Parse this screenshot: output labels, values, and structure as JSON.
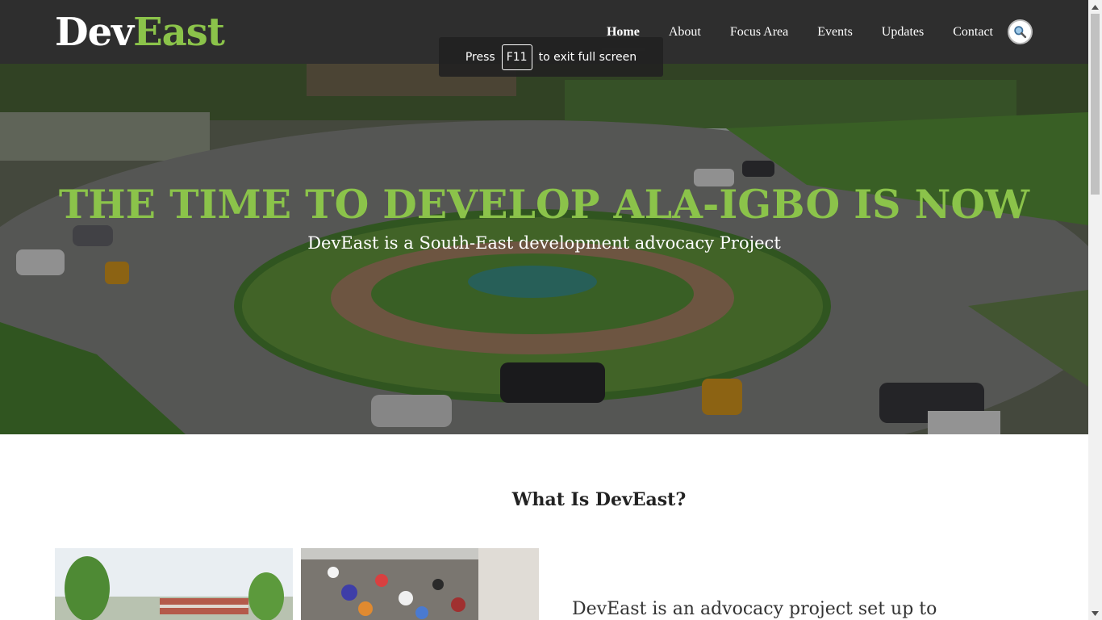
{
  "header": {
    "logo_dev": "Dev",
    "logo_east": "East",
    "nav": [
      {
        "label": "Home"
      },
      {
        "label": "About"
      },
      {
        "label": "Focus Area"
      },
      {
        "label": "Events"
      },
      {
        "label": "Updates"
      },
      {
        "label": "Contact"
      }
    ],
    "active_nav": "Home",
    "search_icon": "search-icon"
  },
  "toast": {
    "prefix": "Press",
    "key": "F11",
    "suffix": "to exit full screen"
  },
  "hero": {
    "title": "THE TIME TO DEVELOP ALA-IGBO IS NOW",
    "subtitle": "DevEast is a South-East development advocacy Project"
  },
  "about": {
    "title": "What Is DevEast?",
    "intro": "DevEast is an advocacy project set up to"
  },
  "colors": {
    "accent": "#8bc34a",
    "header_bg": "#2e2e2e",
    "text_dark": "#222222"
  }
}
